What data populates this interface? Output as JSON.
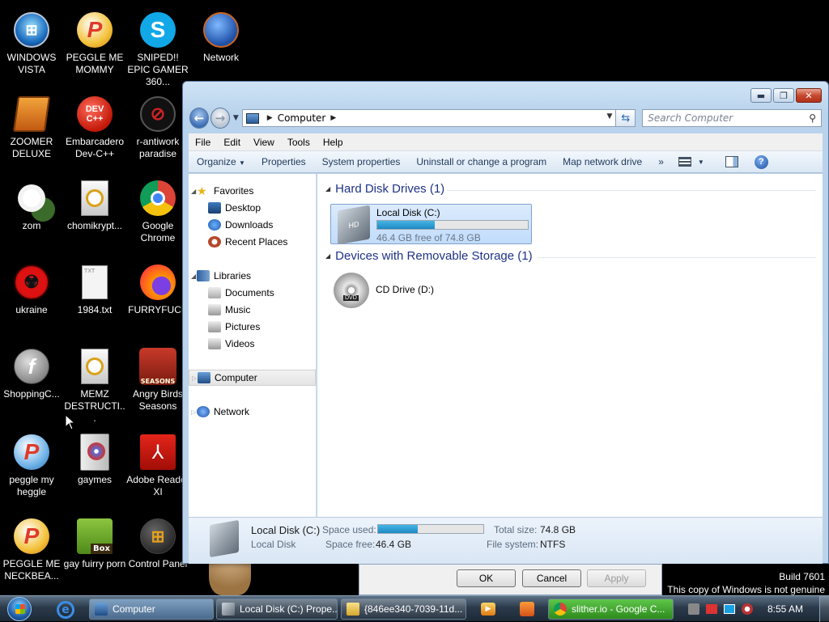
{
  "desktop": {
    "icons": [
      {
        "label": "WINDOWS VISTA"
      },
      {
        "label": "PEGGLE ME MOMMY"
      },
      {
        "label": "SNIPED!! EPIC GAMER 360..."
      },
      {
        "label": "Network"
      },
      {
        "label": "ZOOMER DELUXE"
      },
      {
        "label": "Embarcadero Dev-C++"
      },
      {
        "label": "r-antiwork paradise"
      },
      {
        "label": "zom"
      },
      {
        "label": "chomikrypt..."
      },
      {
        "label": "Google Chrome"
      },
      {
        "label": "ukraine"
      },
      {
        "label": "1984.txt"
      },
      {
        "label": "FURRYFUCK"
      },
      {
        "label": "ShoppingC..."
      },
      {
        "label": "MEMZ DESTRUCTI..."
      },
      {
        "label": "Angry Birds Seasons"
      },
      {
        "label": "peggle my heggle"
      },
      {
        "label": "gaymes"
      },
      {
        "label": "Adobe Reader XI"
      },
      {
        "label": "PEGGLE ME NECKBEA..."
      },
      {
        "label": "gay fuirry porn"
      },
      {
        "label": "Control Panel"
      }
    ],
    "icon_glyphs": {
      "dev": "DEV C++",
      "txt": "TXT",
      "box": "Box",
      "dvd": "DVD",
      "hd": "HD",
      "seasons": "SEASONS"
    }
  },
  "explorer": {
    "address_segment": "Computer",
    "search_placeholder": "Search Computer",
    "menu": [
      "File",
      "Edit",
      "View",
      "Tools",
      "Help"
    ],
    "commands": {
      "organize": "Organize",
      "properties": "Properties",
      "system_properties": "System properties",
      "uninstall": "Uninstall or change a program",
      "map_drive": "Map network drive",
      "more": "»"
    },
    "nav": {
      "favorites": "Favorites",
      "desktop": "Desktop",
      "downloads": "Downloads",
      "recent": "Recent Places",
      "libraries": "Libraries",
      "documents": "Documents",
      "music": "Music",
      "pictures": "Pictures",
      "videos": "Videos",
      "computer": "Computer",
      "network": "Network"
    },
    "groups": {
      "hdd": "Hard Disk Drives (1)",
      "removable": "Devices with Removable Storage (1)"
    },
    "drive_c": {
      "name": "Local Disk (C:)",
      "free": "46.4 GB free of 74.8 GB",
      "used_fraction": 0.38
    },
    "drive_d": {
      "name": "CD Drive (D:)"
    },
    "details": {
      "name": "Local Disk (C:)",
      "type": "Local Disk",
      "space_used_label": "Space used:",
      "space_free_label": "Space free:",
      "space_free": "46.4 GB",
      "total_label": "Total size:",
      "total": "74.8 GB",
      "fs_label": "File system:",
      "fs": "NTFS"
    },
    "caption": {
      "minimize": "▬",
      "maximize": "❐",
      "close": "✕"
    }
  },
  "dialog": {
    "ok": "OK",
    "cancel": "Cancel",
    "apply": "Apply"
  },
  "genuine": {
    "build": "Build 7601",
    "notice": "This copy of Windows is not genuine"
  },
  "taskbar": {
    "items": [
      {
        "label": "Computer"
      },
      {
        "label": "Local Disk (C:) Prope..."
      },
      {
        "label": "{846ee340-7039-11d..."
      },
      {
        "label": "slither.io - Google C..."
      }
    ],
    "clock": "8:55 AM"
  },
  "colors": {
    "accent": "#1d8ac3",
    "group_heading": "#1e3287",
    "close_red": "#c54a30"
  }
}
